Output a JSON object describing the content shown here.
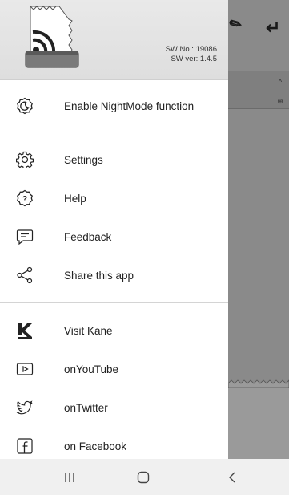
{
  "header": {
    "sw_no": "SW No.: 19086",
    "sw_ver": "SW ver: 1.4.5"
  },
  "night_mode": {
    "label": "Enable NightMode function",
    "icon": "night-mode-icon"
  },
  "main_menu": [
    {
      "label": "Settings",
      "icon": "gear-icon"
    },
    {
      "label": "Help",
      "icon": "help-icon"
    },
    {
      "label": "Feedback",
      "icon": "feedback-icon"
    },
    {
      "label": "Share this app",
      "icon": "share-icon"
    }
  ],
  "links_menu": [
    {
      "label": "Visit Kane",
      "icon": "kane-logo-icon"
    },
    {
      "label": "onYouTube",
      "icon": "youtube-icon"
    },
    {
      "label": "onTwitter",
      "icon": "twitter-icon"
    },
    {
      "label": "on Facebook",
      "icon": "facebook-icon"
    }
  ],
  "system_nav": {
    "recents_icon": "recents-icon",
    "home_icon": "home-icon",
    "back_icon": "back-icon"
  }
}
